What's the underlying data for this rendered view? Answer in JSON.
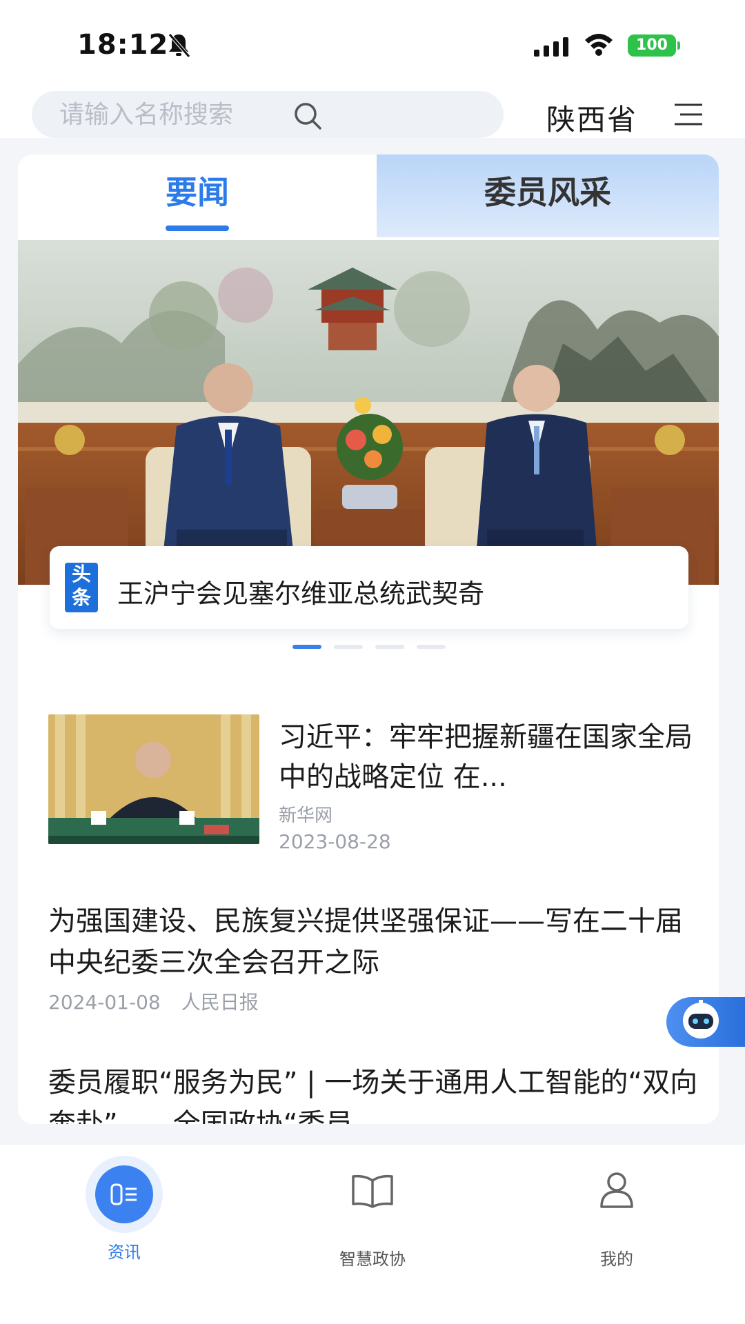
{
  "status_bar": {
    "time": "18:12",
    "battery": "100",
    "icons": [
      "bell-muted-icon",
      "signal-icon",
      "wifi-icon",
      "battery-icon"
    ]
  },
  "header": {
    "search_placeholder": "请输入名称搜索",
    "region": "陕西省"
  },
  "tabs": [
    {
      "label": "要闻",
      "active": true
    },
    {
      "label": "委员风采",
      "active": false
    }
  ],
  "headline": {
    "badge": "头条",
    "title": "王沪宁会见塞尔维亚总统武契奇"
  },
  "carousel": {
    "count": 4,
    "active_index": 0
  },
  "news": [
    {
      "title": "习近平：牢牢把握新疆在国家全局中的战略定位 在...",
      "source": "新华网",
      "date": "2023-08-28"
    },
    {
      "title": "为强国建设、民族复兴提供坚强保证——写在二十届中央纪委三次全会召开之际",
      "date": "2024-01-08",
      "source": "人民日报"
    },
    {
      "title": "委员履职“服务为民” | 一场关于通用人工智能的“双向奔赴”——全国政协“委员..."
    }
  ],
  "bottom_nav": [
    {
      "label": "资讯",
      "icon": "news-icon",
      "active": true
    },
    {
      "label": "智慧政协",
      "icon": "book-icon",
      "active": false
    },
    {
      "label": "我的",
      "icon": "user-icon",
      "active": false
    }
  ],
  "colors": {
    "accent": "#2b7bea",
    "tab_inactive_bg": "#cfe1fa",
    "battery": "#2fc24a",
    "muted_text": "#9a9fa8"
  }
}
